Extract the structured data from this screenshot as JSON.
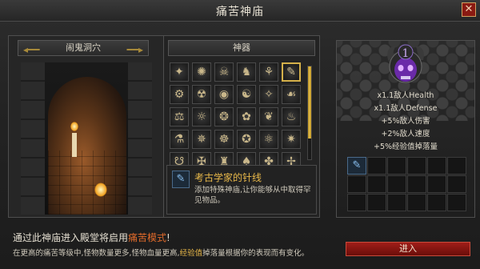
{
  "window": {
    "title": "痛苦神庙",
    "close_label": "✕"
  },
  "location": {
    "name": "闹鬼洞穴",
    "prev_arrow": "◂━━",
    "next_arrow": "━━▸"
  },
  "relics": {
    "header": "神器",
    "items": [
      {
        "icon": "✦"
      },
      {
        "icon": "✺"
      },
      {
        "icon": "☠"
      },
      {
        "icon": "♞"
      },
      {
        "icon": "⚘"
      },
      {
        "icon": "✎"
      },
      {
        "icon": "⚙"
      },
      {
        "icon": "☢"
      },
      {
        "icon": "◉"
      },
      {
        "icon": "☯"
      },
      {
        "icon": "✧"
      },
      {
        "icon": "☙"
      },
      {
        "icon": "⚖"
      },
      {
        "icon": "☼"
      },
      {
        "icon": "❂"
      },
      {
        "icon": "✿"
      },
      {
        "icon": "❦"
      },
      {
        "icon": "♨"
      },
      {
        "icon": "⚗"
      },
      {
        "icon": "✵"
      },
      {
        "icon": "☸"
      },
      {
        "icon": "✪"
      },
      {
        "icon": "⚛"
      },
      {
        "icon": "✷"
      },
      {
        "icon": "☋"
      },
      {
        "icon": "✠"
      },
      {
        "icon": "♜"
      },
      {
        "icon": "♠"
      },
      {
        "icon": "✤"
      },
      {
        "icon": "✢"
      }
    ],
    "selected_index": 5,
    "scroll_fraction": 0.78
  },
  "selected_relic": {
    "icon": "✎",
    "name": "考古学家的针线",
    "description": "添加特殊神庙,让你能够从中取得罕见物品。"
  },
  "torment": {
    "level": "1",
    "bonuses": [
      "x1.1敌人Health",
      "x1.1敌人Defense",
      "+5%敌人伤害",
      "+2%敌人速度",
      "+5%经验值掉落量"
    ],
    "equipped_icon": "✎",
    "slot_count": 18
  },
  "footer": {
    "line1_a": "通过此神庙进入殿堂将启用",
    "line1_highlight": "痛苦模式",
    "line1_b": "!",
    "line2_a": "在更高的痛苦等级中,怪物数量更多,怪物血量更高,",
    "line2_highlight": "经验值",
    "line2_b": "掉落量根据你的表现而有变化。"
  },
  "enter_button": {
    "label": "进入"
  },
  "colors": {
    "accent_gold": "#d4b04a",
    "torment_red": "#e06a2a",
    "emblem_purple": "#8a3ac8"
  }
}
